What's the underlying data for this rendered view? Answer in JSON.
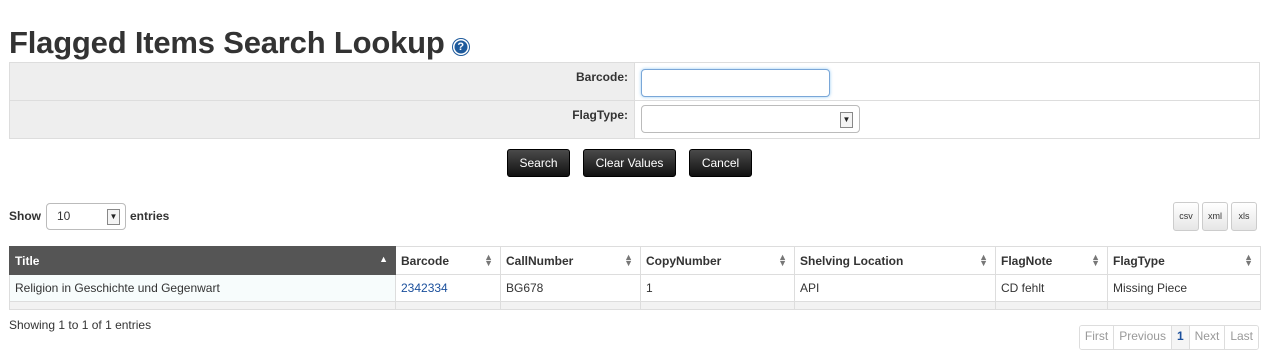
{
  "page": {
    "title": "Flagged Items Search Lookup",
    "help_icon": "question-mark-circle-icon",
    "help_glyph": "?"
  },
  "form": {
    "barcode_label": "Barcode:",
    "barcode_value": "",
    "flagtype_label": "FlagType:",
    "flagtype_value": ""
  },
  "buttons": {
    "search": "Search",
    "clear": "Clear Values",
    "cancel": "Cancel"
  },
  "length": {
    "show_label": "Show",
    "value": "10",
    "entries_label": "entries"
  },
  "export": [
    "csv",
    "xml",
    "xls"
  ],
  "table": {
    "columns": [
      "Title",
      "Barcode",
      "CallNumber",
      "CopyNumber",
      "Shelving Location",
      "FlagNote",
      "FlagType"
    ],
    "sorted_column": "Title",
    "rows": [
      {
        "title": "Religion in Geschichte und Gegenwart",
        "barcode": "2342334",
        "call_number": "BG678",
        "copy_number": "1",
        "shelving_location": "API",
        "flag_note": "CD fehlt",
        "flag_type": "Missing Piece"
      }
    ]
  },
  "info": "Showing 1 to 1 of 1 entries",
  "pagination": {
    "first": "First",
    "previous": "Previous",
    "current": "1",
    "next": "Next",
    "last": "Last"
  },
  "colors": {
    "sorted_header": "#555555",
    "link": "#1a4f9c",
    "button_dark": "#222222"
  }
}
